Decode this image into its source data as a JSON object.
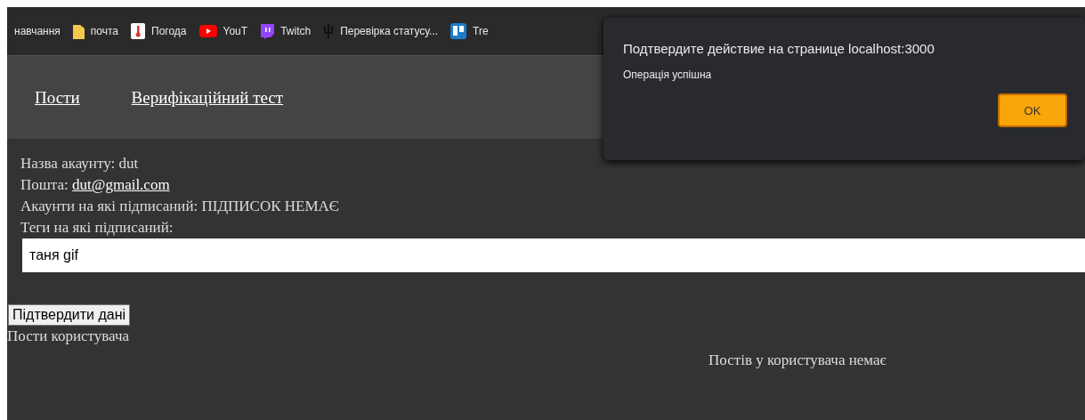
{
  "bookmarks": [
    {
      "label": "навчання",
      "kind": "none"
    },
    {
      "label": "почта",
      "kind": "folder"
    },
    {
      "label": "Погода",
      "kind": "thermometer"
    },
    {
      "label": "YouT",
      "kind": "play"
    },
    {
      "label": "Twitch",
      "kind": "chat"
    },
    {
      "label": "Перевірка статусу...",
      "kind": "trident"
    },
    {
      "label": "Tre",
      "kind": "board"
    }
  ],
  "nav": {
    "links": [
      "Пости",
      "Верифікаційний тест"
    ]
  },
  "profile": {
    "account_name": "Назва акаунту: dut",
    "email_label": "Пошта:",
    "email": "dut@gmail.com",
    "subscriptions": "Акаунти на які підписаний: ПІДПИСОК НЕМАЄ",
    "tags_label": "Теги на які підписаний:",
    "tags_value": "таня gif",
    "confirm_button": "Підтвердити дані",
    "posts_heading": "Пости користувача",
    "posts_empty": "Постів у користувача немає"
  },
  "dialog": {
    "title": "Подтвердите действие на странице localhost:3000",
    "message": "Операція успішна",
    "ok_button": "OK"
  }
}
